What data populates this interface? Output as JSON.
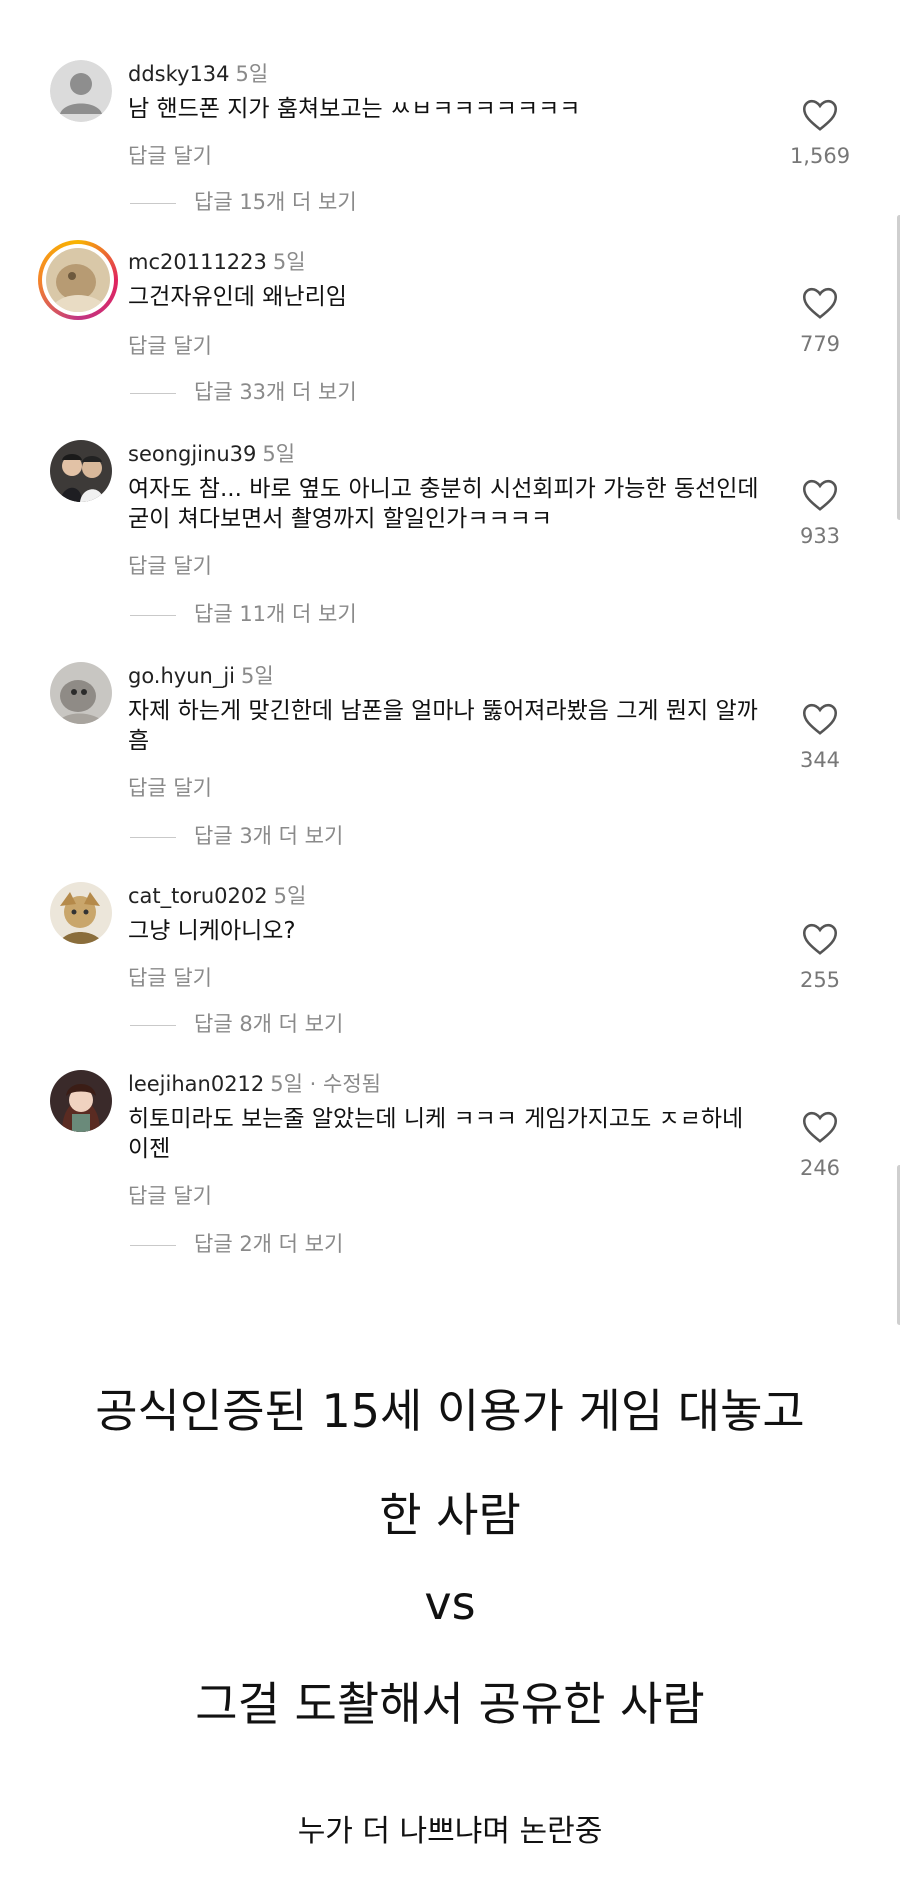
{
  "comments": [
    {
      "username": "ddsky134",
      "time": "5일",
      "edited": "",
      "text": "남 핸드폰 지가 훔쳐보고는 ㅆㅂㅋㅋㅋㅋㅋㅋㅋ",
      "reply_label": "답글 달기",
      "more_replies": "답글 15개 더 보기",
      "likes": "1,569",
      "avatar_icon": "default-user-icon"
    },
    {
      "username": "mc20111223",
      "time": "5일",
      "edited": "",
      "text": "그건자유인데 왜난리임",
      "reply_label": "답글 달기",
      "more_replies": "답글 33개 더 보기",
      "likes": "779",
      "avatar_icon": "story-ring-avatar"
    },
    {
      "username": "seongjinu39",
      "time": "5일",
      "edited": "",
      "text": "여자도 참... 바로 옆도 아니고 충분히 시선회피가 가능한 동선인데 굳이 쳐다보면서 촬영까지 할일인가ㅋㅋㅋㅋ",
      "reply_label": "답글 달기",
      "more_replies": "답글 11개 더 보기",
      "likes": "933",
      "avatar_icon": "photo-avatar"
    },
    {
      "username": "go.hyun_ji",
      "time": "5일",
      "edited": "",
      "text": "자제 하는게 맞긴한데 남폰을 얼마나 뚫어져라봤음 그게 뭔지 알까 흠",
      "reply_label": "답글 달기",
      "more_replies": "답글 3개 더 보기",
      "likes": "344",
      "avatar_icon": "photo-avatar"
    },
    {
      "username": "cat_toru0202",
      "time": "5일",
      "edited": "",
      "text": "그냥 니케아니오?",
      "reply_label": "답글 달기",
      "more_replies": "답글 8개 더 보기",
      "likes": "255",
      "avatar_icon": "photo-avatar"
    },
    {
      "username": "leejihan0212",
      "time": "5일",
      "edited": " · 수정됨",
      "text": "히토미라도 보는줄 알았는데 니케 ㅋㅋㅋ 게임가지고도 ㅈㄹ하네 이젠",
      "reply_label": "답글 달기",
      "more_replies": "답글 2개 더 보기",
      "likes": "246",
      "avatar_icon": "photo-avatar"
    }
  ],
  "caption": {
    "line1": "공식인증된 15세 이용가 게임 대놓고",
    "line2": "한 사람",
    "vs": "vs",
    "line3": "그걸 도촬해서 공유한 사람",
    "line4": "누가 더 나쁘냐며 논란중"
  },
  "colors": {
    "muted": "#8a8a8a",
    "text": "#111111",
    "background": "#ffffff"
  }
}
